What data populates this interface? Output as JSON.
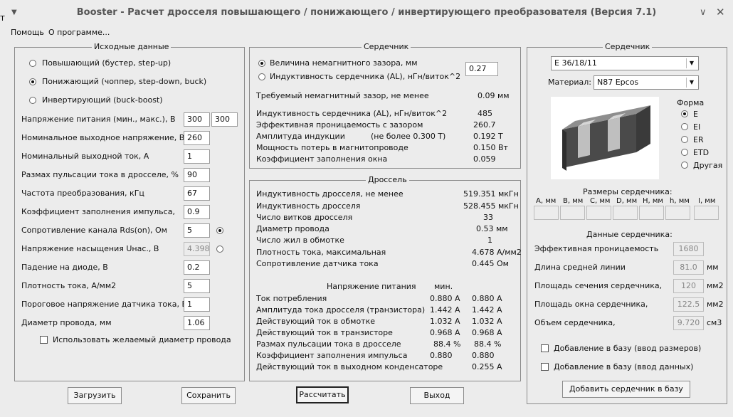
{
  "window": {
    "title": "Booster - Расчет дросселя повышающего / понижающего / инвертирующего преобразователя (Версия 7.1)",
    "minimize": "∨",
    "close": "✕",
    "menu_arrow": "▼",
    "stray_char": "т"
  },
  "menu": {
    "help": "Помощь",
    "about": "О программе..."
  },
  "input": {
    "title": "Исходные данные",
    "modes": [
      {
        "label": "Повышающий (бустер, step-up)",
        "selected": false
      },
      {
        "label": "Понижающий (чоппер, step-down, buck)",
        "selected": true
      },
      {
        "label": "Инвертирующий (buck-boost)",
        "selected": false
      }
    ],
    "supply": {
      "label": "Напряжение питания (мин., макс.), В",
      "min": "300",
      "max": "300"
    },
    "vout": {
      "label": "Номинальное выходное напряжение, В",
      "value": "260"
    },
    "iout": {
      "label": "Номинальный выходной ток, А",
      "value": "1"
    },
    "ripple": {
      "label": "Размах пульсации тока в дросселе, %",
      "value": "90"
    },
    "freq": {
      "label": "Частота преобразования, кГц",
      "value": "67"
    },
    "duty": {
      "label": "Коэффициент заполнения импульса,",
      "value": "0.9"
    },
    "rds": {
      "label": "Сопротивление канала Rds(on), Ом",
      "value": "5"
    },
    "usat": {
      "label": "Напряжение насыщения Uнас., В",
      "value": "4.398"
    },
    "vdiode": {
      "label": "Падение на диоде, В",
      "value": "0.2"
    },
    "jdens": {
      "label": "Плотность тока, А/мм2",
      "value": "5"
    },
    "vsense": {
      "label": "Пороговое напряжение датчика тока, В",
      "value": "1"
    },
    "wire": {
      "label": "Диаметр провода, мм",
      "value": "1.06"
    },
    "use_wire": {
      "label": "Использовать желаемый диаметр провода"
    }
  },
  "core_calc": {
    "title": "Сердечник",
    "gap_option": "Величина немагнитного зазора, мм",
    "al_option": "Индуктивность сердечника (AL), нГн/виток^2",
    "gap_value": "0.27",
    "required_gap_label": "Требуемый немагнитный зазор, не менее",
    "required_gap_value": "0.09 мм",
    "rows": [
      {
        "label": "Индуктивность сердечника (AL), нГн/виток^2",
        "value": "485"
      },
      {
        "label": "Эффективная проницаемость с зазором",
        "value": "260.7"
      },
      {
        "label": "Амплитуда индукции",
        "note": "(не более 0.300 Т)",
        "value": "0.192 Т"
      },
      {
        "label": "Мощность потерь в магнитопроводе",
        "value": "0.150 Вт"
      },
      {
        "label": "Коэффициент заполнения окна",
        "value": "0.059"
      }
    ]
  },
  "choke": {
    "title": "Дроссель",
    "rows": [
      {
        "label": "Индуктивность дросселя, не менее",
        "value": "519.351 мкГн"
      },
      {
        "label": "Индуктивность дросселя",
        "value": "528.455 мкГн"
      },
      {
        "label": "Число витков дросселя",
        "value": "33"
      },
      {
        "label": "Диаметр провода",
        "value": "0.53 мм"
      },
      {
        "label": "Число жил в обмотке",
        "value": "1"
      },
      {
        "label": "Плотность тока, максимальная",
        "value": "4.678 А/мм2"
      },
      {
        "label": "Сопротивление датчика тока",
        "value": "0.445 Ом"
      }
    ],
    "supply_header": "Напряжение питания",
    "min_header": "мин.",
    "table": [
      {
        "label": "Ток потребления",
        "min": "0.880 А",
        "max": "0.880 А"
      },
      {
        "label": "Амплитуда тока дросселя (транзистора)",
        "min": "1.442 А",
        "max": "1.442 А"
      },
      {
        "label": "Действующий ток в обмотке",
        "min": "1.032 А",
        "max": "1.032 А"
      },
      {
        "label": "Действующий ток в транзисторе",
        "min": "0.968 А",
        "max": "0.968 А"
      },
      {
        "label": "Размах пульсации тока в дросселе",
        "min": "88.4 %",
        "max": "88.4 %"
      },
      {
        "label": "Коэффициент заполнения импульса",
        "min": "0.880",
        "max": "0.880"
      },
      {
        "label": "Действующий ток в выходном конденсаторе",
        "min": "",
        "max": "0.255 А"
      }
    ]
  },
  "core_db": {
    "title": "Сердечник",
    "core_select": "E 36/18/11",
    "material_label": "Материал:",
    "material_select": "N87 Epcos",
    "shape_title": "Форма",
    "shapes": [
      {
        "label": "E",
        "selected": true
      },
      {
        "label": "EI",
        "selected": false
      },
      {
        "label": "ER",
        "selected": false
      },
      {
        "label": "ETD",
        "selected": false
      },
      {
        "label": "Другая",
        "selected": false
      }
    ],
    "dims_title": "Размеры сердечника:",
    "dims": [
      "A, мм",
      "B, мм",
      "C, мм",
      "D, мм",
      "H, мм",
      "h, мм",
      "I, мм"
    ],
    "data_title": "Данные сердечника:",
    "params": [
      {
        "label": "Эффективная проницаемость",
        "value": "1680",
        "unit": ""
      },
      {
        "label": "Длина средней линии",
        "value": "81.0",
        "unit": "мм"
      },
      {
        "label": "Площадь сечения сердечника,",
        "value": "120",
        "unit": "мм2"
      },
      {
        "label": "Площадь окна сердечника,",
        "value": "122.5",
        "unit": "мм2"
      },
      {
        "label": "Объем сердечника,",
        "value": "9.720",
        "unit": "см3"
      }
    ],
    "add_dims": "Добавление в базу (ввод размеров)",
    "add_data": "Добавление в базу (ввод данных)",
    "add_button": "Добавить сердечник в базу"
  },
  "buttons": {
    "load": "Загрузить",
    "save": "Сохранить",
    "calc": "Рассчитать",
    "exit": "Выход"
  },
  "colors": {
    "window_bg": "#ececec",
    "field_bg": "#ffffff",
    "border": "#8a8a8a"
  }
}
